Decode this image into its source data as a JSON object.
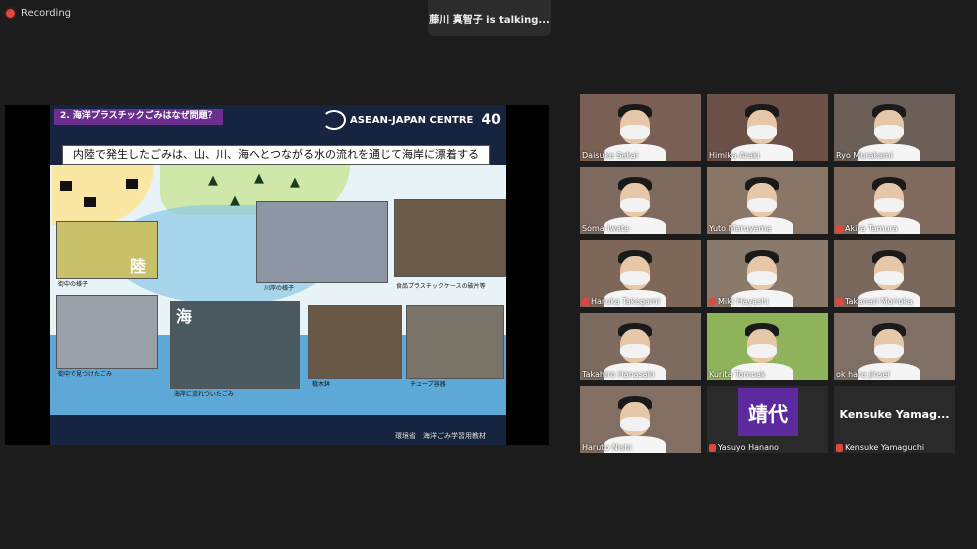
{
  "recording": {
    "label": "Recording"
  },
  "talking": {
    "text": "藤川 真智子 is talking..."
  },
  "slide": {
    "title": "2. 海洋プラスチックごみはなぜ問題？",
    "logo_text": "ASEAN-JAPAN CENTRE",
    "anniversary": "40",
    "subtitle": "内陸で発生したごみは、山、川、海へとつながる水の流れを通じて海岸に漂着する",
    "captions": {
      "street": "街中の様子",
      "river": "川岸の様子",
      "food": "食品プラスチックケースの破片等",
      "street_found": "街中で見つけたごみ",
      "pot": "植木鉢",
      "tube": "チューブ容器",
      "coast": "海岸に流れついたごみ"
    },
    "land_label": "陸",
    "sea_label": "海",
    "credit": "環境省　海洋ごみ学習用教材"
  },
  "participants": [
    {
      "name": "Daisuke Sakai",
      "muted": false,
      "bg": "#7a5f55"
    },
    {
      "name": "Himika Araki",
      "muted": false,
      "bg": "#6b5048"
    },
    {
      "name": "Ryo Murakami",
      "muted": false,
      "bg": "#6b5f57"
    },
    {
      "name": "Soma Iwata",
      "muted": false,
      "bg": "#7e6a5e"
    },
    {
      "name": "Yuto Maruyama",
      "muted": false,
      "bg": "#8a7666"
    },
    {
      "name": "Akira Tamura",
      "muted": true,
      "bg": "#7f6a5d"
    },
    {
      "name": "Haruka Takegami",
      "muted": true,
      "bg": "#7e6758"
    },
    {
      "name": "Miki Hayashi",
      "muted": true,
      "bg": "#8a7a6c"
    },
    {
      "name": "Takanari Morioka",
      "muted": true,
      "bg": "#7a685c"
    },
    {
      "name": "Takahiro Hanasaki",
      "muted": false,
      "bg": "#7d6b60"
    },
    {
      "name": "Kurita Tomoak",
      "muted": false,
      "bg": "#8fb35a"
    },
    {
      "name": "ok hara jinsei",
      "muted": false,
      "bg": "#7f6f64"
    },
    {
      "name": "Haruto Nishi",
      "muted": false,
      "bg": "#826e62"
    },
    {
      "name": "Yasuyo Hanano",
      "muted": true,
      "bg": "#2a2a2a",
      "avatar_text": "靖代"
    },
    {
      "name": "Kensuke Yamaguchi",
      "muted": true,
      "bg": "#2a2a2a",
      "avatar_text": "Kensuke  Yamag..."
    }
  ]
}
